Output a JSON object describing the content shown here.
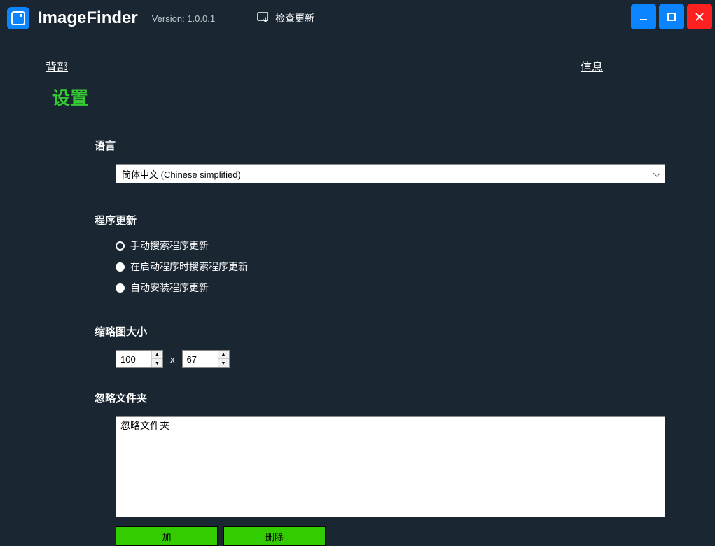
{
  "header": {
    "app_title": "ImageFinder",
    "version_label": "Version: 1.0.0.1",
    "check_update": "检查更新"
  },
  "nav": {
    "back": "背部",
    "info": "信息"
  },
  "page": {
    "heading": "设置"
  },
  "language": {
    "label": "语言",
    "selected": "简体中文 (Chinese simplified)"
  },
  "updates": {
    "label": "程序更新",
    "options": {
      "manual": "手动搜索程序更新",
      "on_start": "在启动程序时搜索程序更新",
      "auto": "自动安装程序更新"
    }
  },
  "thumbnail": {
    "label": "缩略图大小",
    "width": "100",
    "height": "67",
    "x": "x"
  },
  "ignore": {
    "label": "忽略文件夹",
    "list_header": "忽略文件夹"
  },
  "buttons": {
    "add": "加",
    "delete": "删除"
  }
}
